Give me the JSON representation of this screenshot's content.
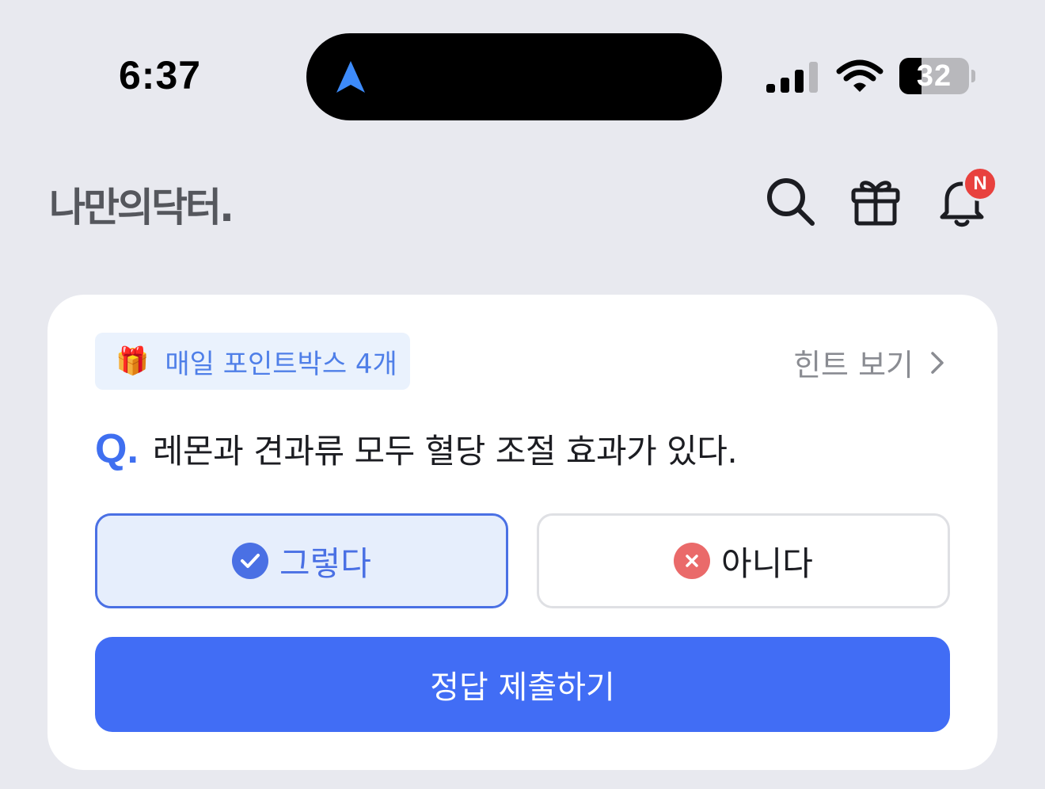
{
  "status_bar": {
    "time": "6:37",
    "battery": "32",
    "battery_level": 0.32,
    "icons": [
      "location-arrow-icon",
      "cellular-signal-icon",
      "wifi-icon",
      "battery-icon"
    ]
  },
  "header": {
    "logo": "나만의닥터.",
    "icons": [
      "search-icon",
      "gift-icon",
      "bell-icon"
    ],
    "notification_badge": "N"
  },
  "quiz_card": {
    "pointbox_icon": "🎁",
    "pointbox_label": "매일 포인트박스 4개",
    "hint_label": "힌트 보기",
    "question_marker": "Q.",
    "question": "레몬과 견과류 모두 혈당 조절 효과가 있다.",
    "choices": [
      {
        "label": "그렇다",
        "icon": "check-circle-icon",
        "selected": true
      },
      {
        "label": "아니다",
        "icon": "x-circle-icon",
        "selected": false
      }
    ],
    "submit_label": "정답 제출하기"
  },
  "colors": {
    "primary": "#416df5",
    "accent_blue": "#4a70e4",
    "badge_red": "#e8413e",
    "background": "#e8e9ef"
  }
}
